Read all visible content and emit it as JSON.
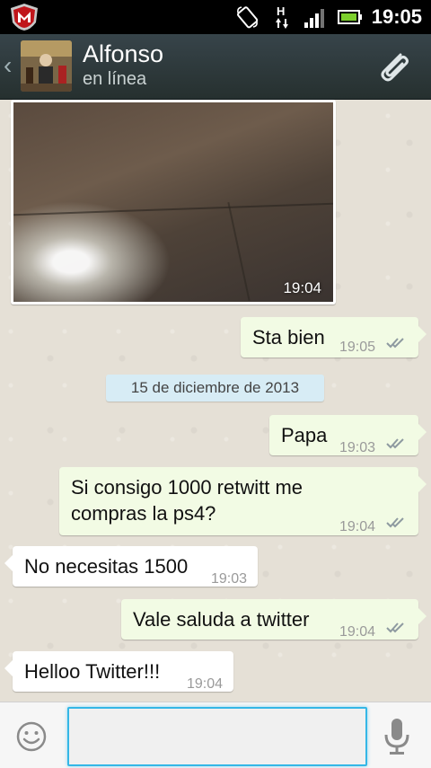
{
  "status_bar": {
    "time": "19:05",
    "network": "H"
  },
  "header": {
    "name": "Alfonso",
    "status": "en línea"
  },
  "messages": [
    {
      "direction": "in",
      "type": "image",
      "time": "19:04"
    },
    {
      "direction": "out",
      "text": "Sta bien",
      "time": "19:05",
      "ticks": "double"
    },
    {
      "direction": "out",
      "text": "Papa",
      "time": "19:03",
      "ticks": "double"
    },
    {
      "direction": "out",
      "text_line1": "Si consigo 1000 retwitt me",
      "text_line2": "compras la ps4?",
      "time": "19:04",
      "ticks": "double"
    },
    {
      "direction": "in",
      "text": "No necesitas 1500",
      "time": "19:03"
    },
    {
      "direction": "out",
      "text": "Vale saluda a twitter",
      "time": "19:04",
      "ticks": "double"
    },
    {
      "direction": "in",
      "text": "Helloo Twitter!!!",
      "time": "19:04"
    }
  ],
  "date_separator": "15 de diciembre de 2013",
  "input": {
    "placeholder": ""
  },
  "colors": {
    "accent": "#34b7e6",
    "outgoing_bubble": "#f2fbe4",
    "header": "#2f3a3e"
  }
}
